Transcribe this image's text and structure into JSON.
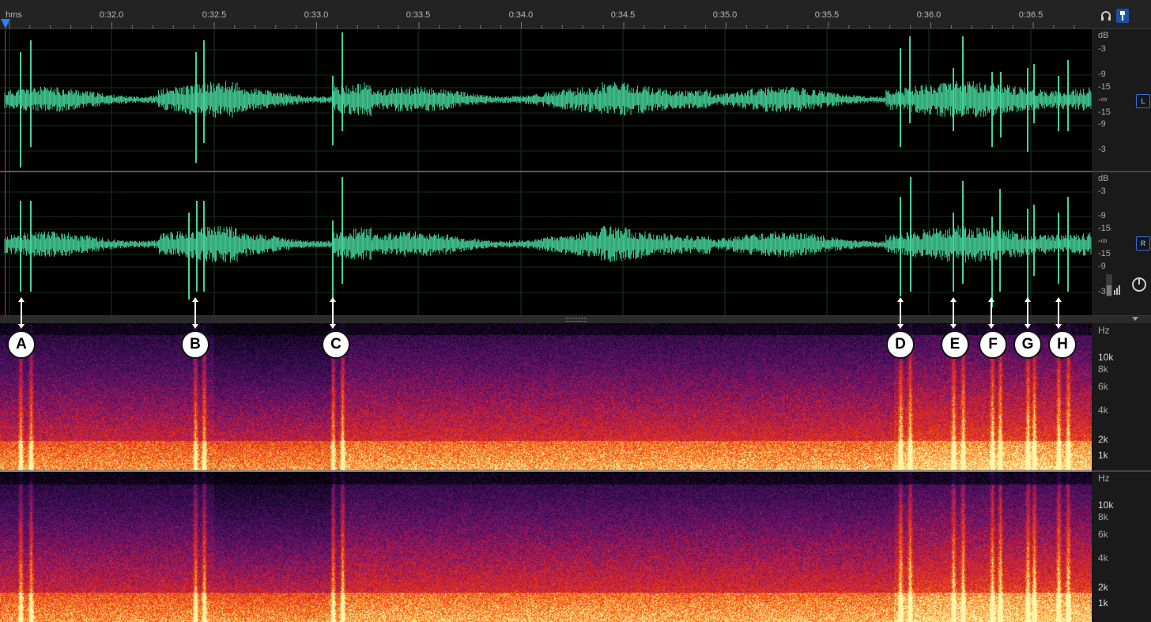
{
  "timeline": {
    "unit_label": "hms",
    "tick_labels": [
      "0:32.0",
      "0:32.5",
      "0:33.0",
      "0:33.5",
      "0:34.0",
      "0:34.5",
      "0:35.0",
      "0:35.5",
      "0:36.0",
      "0:36.5"
    ]
  },
  "toolbar": {
    "headphones_icon": "headphones-icon",
    "pin_icon": "pin-icon"
  },
  "waveform": {
    "color": "#46d39a",
    "channels": [
      {
        "badge": "L",
        "db_labels": [
          "dB",
          "-3",
          "-9",
          "-15",
          "-∞",
          "-15",
          "-9",
          "-3"
        ]
      },
      {
        "badge": "R",
        "db_labels": [
          "dB",
          "-3",
          "-9",
          "-15",
          "-∞",
          "-15",
          "-9",
          "-3"
        ]
      }
    ]
  },
  "spectrogram": {
    "channels": [
      {
        "hz_labels": [
          "Hz",
          "10k",
          "8k",
          "6k",
          "4k",
          "2k",
          "1k"
        ]
      },
      {
        "hz_labels": [
          "Hz",
          "10k",
          "8k",
          "6k",
          "4k",
          "2k",
          "1k"
        ]
      }
    ]
  },
  "markers": [
    "A",
    "B",
    "C",
    "D",
    "E",
    "F",
    "G",
    "H"
  ],
  "side_controls": {
    "meter_icon": "level-meter-icon",
    "power_icon": "power-icon"
  }
}
